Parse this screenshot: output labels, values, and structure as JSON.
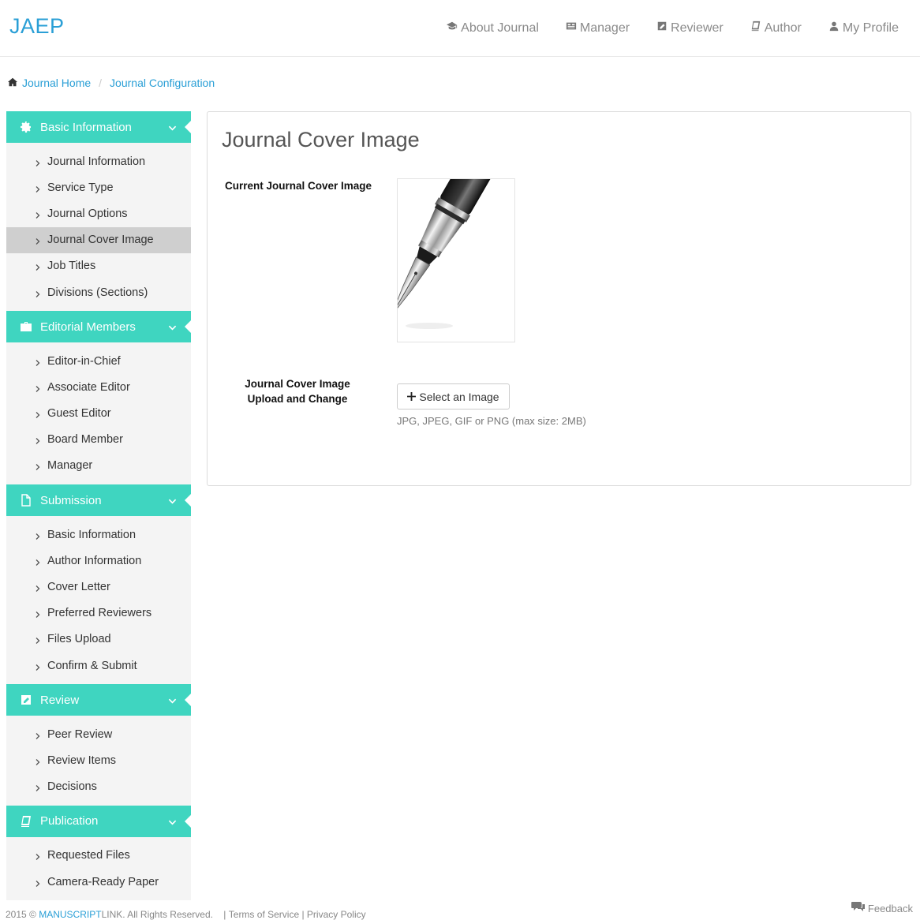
{
  "header": {
    "brand": "JAEP",
    "nav": [
      {
        "label": "About Journal",
        "icon": "graduation-cap-icon"
      },
      {
        "label": "Manager",
        "icon": "id-card-icon"
      },
      {
        "label": "Reviewer",
        "icon": "edit-icon"
      },
      {
        "label": "Author",
        "icon": "book-icon"
      },
      {
        "label": "My Profile",
        "icon": "user-icon"
      }
    ]
  },
  "breadcrumb": {
    "home": "Journal Home",
    "current": "Journal Configuration"
  },
  "sidebar": {
    "sections": [
      {
        "title": "Basic Information",
        "icon": "gear-icon",
        "items": [
          "Journal Information",
          "Service Type",
          "Journal Options",
          "Journal Cover Image",
          "Job Titles",
          "Divisions (Sections)"
        ],
        "active": "Journal Cover Image"
      },
      {
        "title": "Editorial Members",
        "icon": "briefcase-icon",
        "items": [
          "Editor-in-Chief",
          "Associate Editor",
          "Guest Editor",
          "Board Member",
          "Manager"
        ]
      },
      {
        "title": "Submission",
        "icon": "file-icon",
        "items": [
          "Basic Information",
          "Author Information",
          "Cover Letter",
          "Preferred Reviewers",
          "Files Upload",
          "Confirm & Submit"
        ]
      },
      {
        "title": "Review",
        "icon": "edit-icon",
        "items": [
          "Peer Review",
          "Review Items",
          "Decisions"
        ]
      },
      {
        "title": "Publication",
        "icon": "book-icon",
        "items": [
          "Requested Files",
          "Camera-Ready Paper"
        ]
      }
    ]
  },
  "main": {
    "title": "Journal Cover Image",
    "current_label": "Current Journal Cover Image",
    "upload_label_line1": "Journal Cover Image",
    "upload_label_line2": "Upload and Change",
    "select_button": "Select an Image",
    "hint": "JPG, JPEG, GIF or PNG (max size: 2MB)"
  },
  "footer": {
    "copyright_prefix": "2015 ©",
    "brand_a": "MANUSCRIPT",
    "brand_b": "LINK",
    "rights": ". All Rights Reserved.",
    "terms": "Terms of Service",
    "privacy": "Privacy Policy",
    "feedback": "Feedback"
  },
  "colors": {
    "accent": "#3fd5c0",
    "link": "#2a9fd6",
    "active_item_bg": "#cfcfcf",
    "sidebar_bg": "#f4f4f4"
  }
}
